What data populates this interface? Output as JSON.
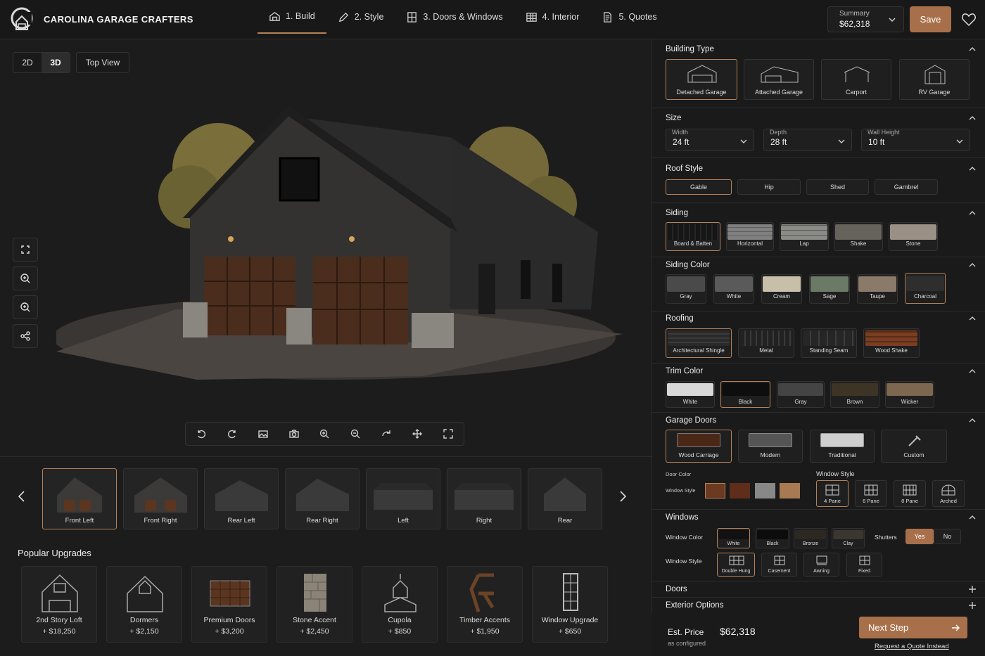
{
  "app": {
    "brand": "CAROLINA GARAGE CRAFTERS",
    "logo_letter": "C"
  },
  "steps": [
    {
      "label": "1. Build",
      "icon": "house-icon"
    },
    {
      "label": "2. Style",
      "icon": "pencil-icon"
    },
    {
      "label": "3. Doors & Windows",
      "icon": "window-icon"
    },
    {
      "label": "4. Interior",
      "icon": "grid-icon"
    },
    {
      "label": "5. Quotes",
      "icon": "document-icon"
    }
  ],
  "summary": {
    "label": "Summary",
    "value": "$62,318"
  },
  "save_label": "Save",
  "view": {
    "twod": "2D",
    "threed": "3D",
    "top": "Top View"
  },
  "thumbs": [
    "Front Left",
    "Front Right",
    "Rear Left",
    "Rear Right",
    "Left",
    "Right",
    "Rear"
  ],
  "popular_title": "Popular Upgrades",
  "upgrades": [
    {
      "name": "2nd Story Loft",
      "price": "+ $18,250"
    },
    {
      "name": "Dormers",
      "price": "+ $2,150"
    },
    {
      "name": "Premium Doors",
      "price": "+ $3,200"
    },
    {
      "name": "Stone Accent",
      "price": "+ $2,450"
    },
    {
      "name": "Cupola",
      "price": "+ $850"
    },
    {
      "name": "Timber Accents",
      "price": "+ $1,950"
    },
    {
      "name": "Window Upgrade",
      "price": "+ $650"
    }
  ],
  "panel": {
    "building_type": {
      "title": "Building Type",
      "options": [
        "Detached Garage",
        "Attached Garage",
        "Carport",
        "RV Garage"
      ]
    },
    "size": {
      "title": "Size",
      "width_label": "Width",
      "width": "24 ft",
      "depth_label": "Depth",
      "depth": "28 ft",
      "height_label": "Wall Height",
      "height": "10 ft"
    },
    "roof_style": {
      "title": "Roof Style",
      "options": [
        "Gable",
        "Hip",
        "Shed",
        "Gambrel"
      ]
    },
    "siding": {
      "title": "Siding",
      "options": [
        "Board & Batten",
        "Horizontal",
        "Lap",
        "Shake",
        "Stone"
      ]
    },
    "siding_color": {
      "title": "Siding Color",
      "options": [
        "Gray",
        "White",
        "Cream",
        "Sage",
        "Taupe",
        "Charcoal"
      ]
    },
    "roofing": {
      "title": "Roofing",
      "options": [
        "Architectural Shingle",
        "Metal",
        "Standing Seam",
        "Wood Shake"
      ]
    },
    "trim_color": {
      "title": "Trim Color",
      "options": [
        "White",
        "Black",
        "Gray",
        "Brown",
        "Wicker"
      ]
    },
    "garage_doors": {
      "title": "Garage Doors",
      "options": [
        "Wood Carriage",
        "Modern",
        "Traditional",
        "Custom"
      ],
      "door_color": "Door Color",
      "window_style_small": "Window Style",
      "window_style": "Window Style",
      "window_options": [
        "4 Pane",
        "6 Pane",
        "8 Pane",
        "Arched"
      ]
    },
    "windows": {
      "title": "Windows",
      "color_label": "Window Color",
      "colors": [
        "White",
        "Black",
        "Bronze",
        "Clay"
      ],
      "shutters": "Shutters",
      "yes": "Yes",
      "no": "No",
      "style_label": "Window Style",
      "styles": [
        "Double Hung",
        "Casement",
        "Awning",
        "Fixed"
      ]
    },
    "doors": {
      "title": "Doors"
    },
    "exterior": {
      "title": "Exterior Options"
    }
  },
  "footer": {
    "est_label": "Est. Price",
    "price": "$62,318",
    "sub": "as configured",
    "next": "Next Step",
    "request": "Request a Quote Instead"
  },
  "colors": {
    "accent": "#b4825a",
    "button": "#a8704a",
    "bg": "#1c1c1c",
    "panel": "#1a1a1a"
  }
}
